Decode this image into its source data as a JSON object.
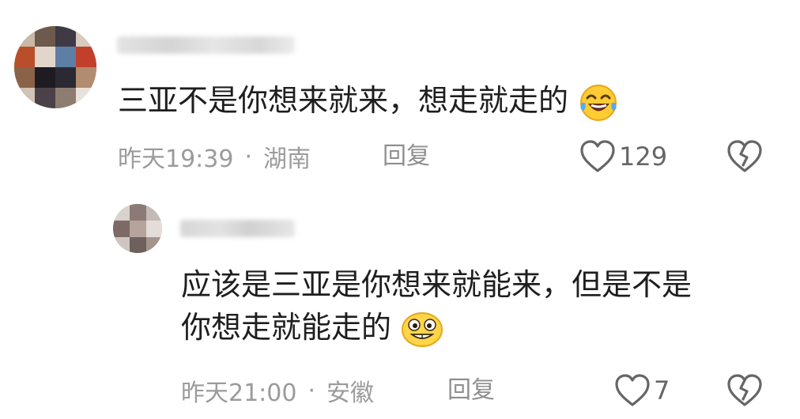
{
  "comment": {
    "text": "三亚不是你想来就来，想走就走的",
    "emoji": "laughing-crying-emoji",
    "time": "昨天19:39",
    "separator": "·",
    "location": "湖南",
    "reply_label": "回复",
    "like_count": "129"
  },
  "reply": {
    "text_line1": "应该是三亚是你想来就能来，但是不是",
    "text_line2": "你想走就能走的",
    "emoji": "grinning-emoji",
    "time": "昨天21:00",
    "separator": "·",
    "location": "安徽",
    "reply_label": "回复",
    "like_count": "7"
  },
  "colors": {
    "text": "#1e1e1e",
    "meta": "#9b9b9b",
    "background": "#ffffff"
  }
}
